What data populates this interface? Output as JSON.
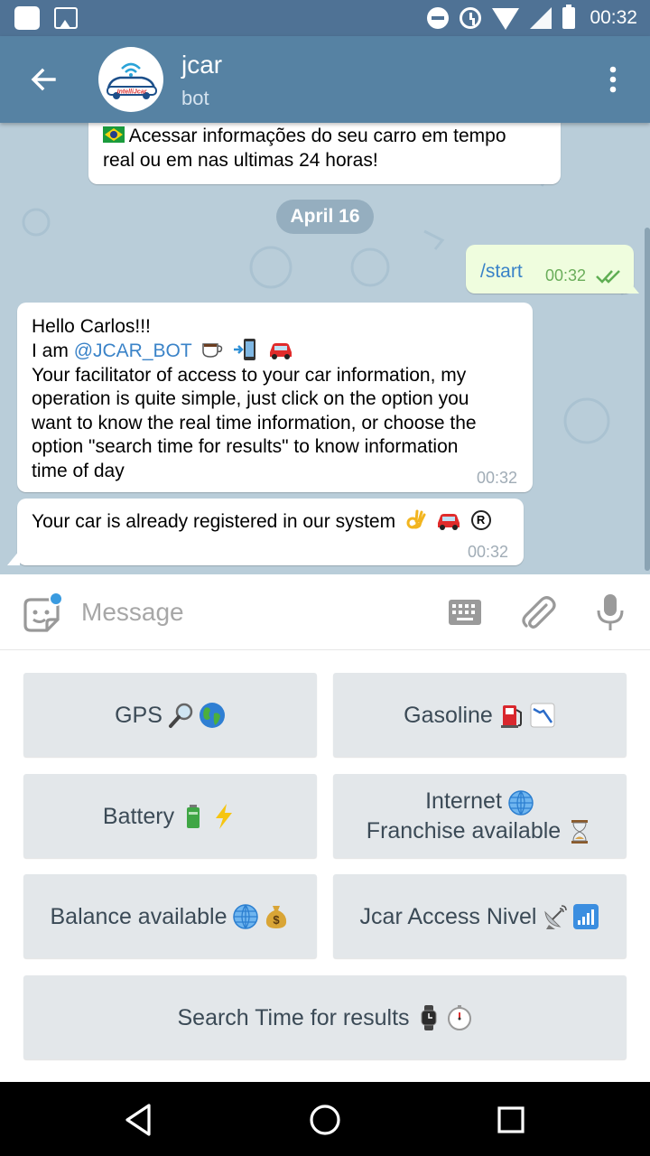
{
  "status_bar": {
    "time": "00:32"
  },
  "header": {
    "title": "jcar",
    "subtitle": "bot",
    "avatar_text": "IntelliJcar"
  },
  "messages": {
    "prev_text": "Acessar informações do seu carro em tempo real ou em nas ultimas 24 horas!",
    "prev_line1": "Acessar informações do seu carro em tempo",
    "prev_line2": "real ou em nas ultimas 24 horas!",
    "date_divider": "April 16",
    "outgoing": {
      "text": "/start",
      "time": "00:32"
    },
    "welcome": {
      "line1": "Hello Carlos!!!",
      "line2_prefix": "I am ",
      "mention": "@JCAR_BOT",
      "line3": "Your facilitator of access to your car information, my",
      "line4": "operation is quite simple, just click on the option you",
      "line5": "want to know the real time information, or choose the",
      "line6": "option \"search time for results\" to know information",
      "line7": "time of day",
      "time": "00:32"
    },
    "registered": {
      "text": "Your car is already registered in our system",
      "time": "00:32"
    }
  },
  "composer": {
    "placeholder": "Message"
  },
  "keyboard": {
    "gps": "GPS",
    "gasoline": "Gasoline",
    "battery": "Battery",
    "internet_line1": "Internet",
    "internet_line2": "Franchise available",
    "balance": "Balance available",
    "access": "Jcar Access Nivel",
    "search": "Search Time for results"
  },
  "colors": {
    "header": "#5682a3",
    "status_bar": "#4f7295",
    "chat_bg": "#b9cdd9",
    "outgoing_bubble": "#effdde",
    "link": "#3a83c8",
    "key_bg": "#e3e7ea"
  }
}
